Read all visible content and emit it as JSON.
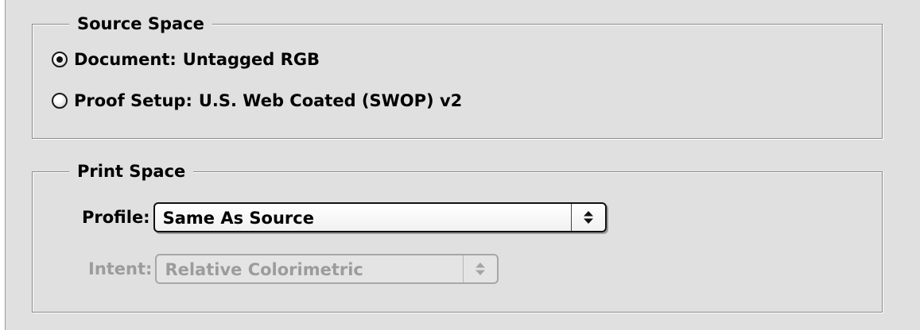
{
  "source_space": {
    "title": "Source Space",
    "options": [
      {
        "prefix": "Document:",
        "value": "Untagged RGB",
        "selected": true
      },
      {
        "prefix": "Proof Setup:",
        "value": "U.S. Web Coated (SWOP) v2",
        "selected": false
      }
    ]
  },
  "print_space": {
    "title": "Print Space",
    "profile": {
      "label": "Profile:",
      "value": "Same As Source",
      "enabled": true,
      "icon": "updown-arrows-icon"
    },
    "intent": {
      "label": "Intent:",
      "value": "Relative Colorimetric",
      "enabled": false,
      "icon": "updown-arrows-icon"
    }
  }
}
